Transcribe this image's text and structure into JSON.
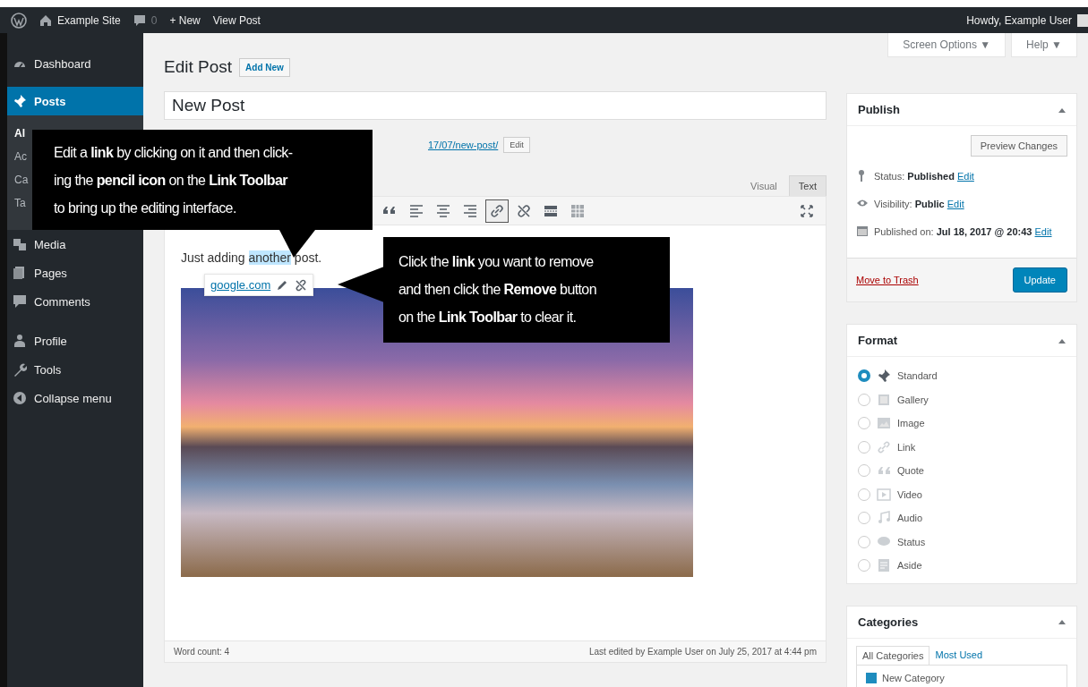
{
  "admin_bar": {
    "site": "Example Site",
    "comments": "0",
    "new": "+ New",
    "view": "View Post",
    "howdy": "Howdy, Example User"
  },
  "sidebar": {
    "items": [
      {
        "label": "Dashboard",
        "kind": "dashboard",
        "selected": false
      },
      {
        "label": "Posts",
        "kind": "posts",
        "selected": true,
        "children": [
          {
            "label": "Al",
            "selected": true
          },
          {
            "label": "Ac",
            "selected": false
          },
          {
            "label": "Ca",
            "selected": false
          },
          {
            "label": "Ta",
            "selected": false
          }
        ]
      },
      {
        "label": "Media",
        "kind": "media",
        "selected": false
      },
      {
        "label": "Pages",
        "kind": "pages",
        "selected": false
      },
      {
        "label": "Comments",
        "kind": "comments",
        "selected": false
      },
      {
        "label": "Profile",
        "kind": "profile",
        "selected": false
      },
      {
        "label": "Tools",
        "kind": "tools",
        "selected": false
      },
      {
        "label": "Collapse menu",
        "kind": "collapse",
        "selected": false
      }
    ]
  },
  "screen_options": [
    "Screen Options ▼",
    "Help ▼"
  ],
  "heading": "Edit Post",
  "add_new": "Add New",
  "post_title": "New Post",
  "permalink": {
    "url": "17/07/new-post/",
    "edit": "Edit"
  },
  "editor_tabs": [
    {
      "label": "Visual",
      "selected": false
    },
    {
      "label": "Text",
      "selected": true
    }
  ],
  "toolbar": [
    {
      "kind": "quote",
      "active": false
    },
    {
      "kind": "align-left",
      "active": false
    },
    {
      "kind": "align-center",
      "active": false
    },
    {
      "kind": "align-right",
      "active": false
    },
    {
      "kind": "link",
      "active": true
    },
    {
      "kind": "unlink",
      "active": false
    },
    {
      "kind": "read-more",
      "active": false
    },
    {
      "kind": "toolbar-toggle",
      "active": false
    }
  ],
  "content": {
    "before": "Just adding ",
    "link": "another",
    "after": " post."
  },
  "link_toolbar": {
    "url": "google.com"
  },
  "word_count": "Word count: 4",
  "last_edited": "Last edited by Example User on July 25, 2017 at 4:44 pm",
  "publish": {
    "title": "Publish",
    "preview": "Preview Changes",
    "rows": [
      {
        "kind": "status",
        "label": "Status: ",
        "value": "Published",
        "edit": "Edit"
      },
      {
        "kind": "visibility",
        "label": "Visibility: ",
        "value": "Public",
        "edit": "Edit"
      },
      {
        "kind": "date",
        "label": "Published on: ",
        "value": "Jul 18, 2017 @ 20:43",
        "edit": "Edit"
      }
    ],
    "trash": "Move to Trash",
    "update": "Update"
  },
  "format": {
    "title": "Format",
    "options": [
      {
        "label": "Standard",
        "kind": "standard",
        "selected": true
      },
      {
        "label": "Gallery",
        "kind": "gallery",
        "selected": false
      },
      {
        "label": "Image",
        "kind": "image",
        "selected": false
      },
      {
        "label": "Link",
        "kind": "link",
        "selected": false
      },
      {
        "label": "Quote",
        "kind": "quote",
        "selected": false
      },
      {
        "label": "Video",
        "kind": "video",
        "selected": false
      },
      {
        "label": "Audio",
        "kind": "audio",
        "selected": false
      },
      {
        "label": "Status",
        "kind": "status",
        "selected": false
      },
      {
        "label": "Aside",
        "kind": "aside",
        "selected": false
      }
    ]
  },
  "categories": {
    "title": "Categories",
    "tabs": [
      {
        "label": "All Categories",
        "selected": true
      },
      {
        "label": "Most Used",
        "selected": false
      }
    ],
    "items": [
      {
        "label": "New Category",
        "checked": true
      }
    ]
  },
  "callouts": [
    {
      "lines": [
        "Edit a **link** by clicking on it and then click-",
        "ing the **pencil icon** on the **Link Toolbar**",
        "to bring up the editing interface."
      ]
    },
    {
      "lines": [
        "Click the **link** you want to remove",
        "and then click the **Remove** button",
        "on the **Link Toolbar** to clear it."
      ]
    }
  ]
}
